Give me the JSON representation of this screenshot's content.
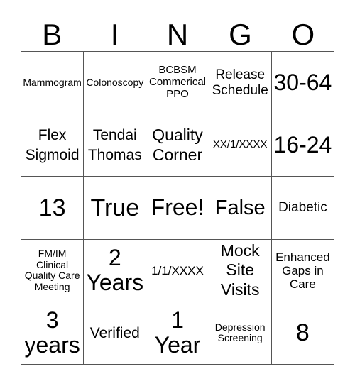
{
  "header": {
    "letters": [
      "B",
      "I",
      "N",
      "G",
      "O"
    ]
  },
  "cells": [
    [
      "Mammogram",
      "Colonoscopy",
      "BCBSM Commerical PPO",
      "Release Schedule",
      "30-64"
    ],
    [
      "Flex Sigmoid",
      "Tendai Thomas",
      "Quality Corner",
      "XX/1/XXXX",
      "16-24"
    ],
    [
      "13",
      "True",
      "Free!",
      "False",
      "Diabetic"
    ],
    [
      "FM/IM Clinical Quality Care Meeting",
      "2 Years",
      "1/1/XXXX",
      "Mock Site Visits",
      "Enhanced Gaps in Care"
    ],
    [
      "3 years",
      "Verified",
      "1 Year",
      "Depression Screening",
      "8"
    ]
  ]
}
